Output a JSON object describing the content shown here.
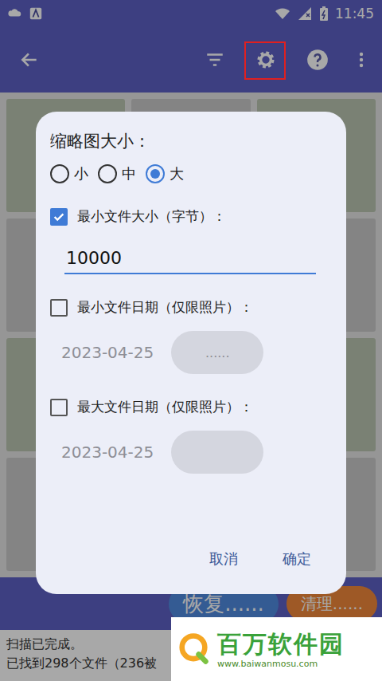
{
  "status_bar": {
    "time": "11:45"
  },
  "toolbar": {
    "settings_highlighted": true
  },
  "dialog": {
    "thumbnail_size": {
      "label": "缩略图大小：",
      "options": [
        {
          "label": "小",
          "selected": false
        },
        {
          "label": "中",
          "selected": false
        },
        {
          "label": "大",
          "selected": true
        }
      ]
    },
    "min_size": {
      "label": "最小文件大小（字节）：",
      "checked": true,
      "value": "10000"
    },
    "min_date": {
      "label": "最小文件日期（仅限照片）：",
      "checked": false,
      "value": "2023-04-25",
      "button": "......"
    },
    "max_date": {
      "label": "最大文件日期（仅限照片）：",
      "checked": false,
      "value": "2023-04-25"
    },
    "buttons": [
      {
        "label": "取消"
      },
      {
        "label": "确定"
      }
    ]
  },
  "bottom_bar": {
    "buttons": [
      {
        "label": "恢复......",
        "kind": "restore"
      },
      {
        "label": "清理......",
        "kind": "clean"
      }
    ]
  },
  "status": [
    "扫描已完成。",
    "已找到298个文件（236被"
  ],
  "watermark": {
    "name": "百万软件园",
    "url": "www.baiwanmosu.com"
  }
}
